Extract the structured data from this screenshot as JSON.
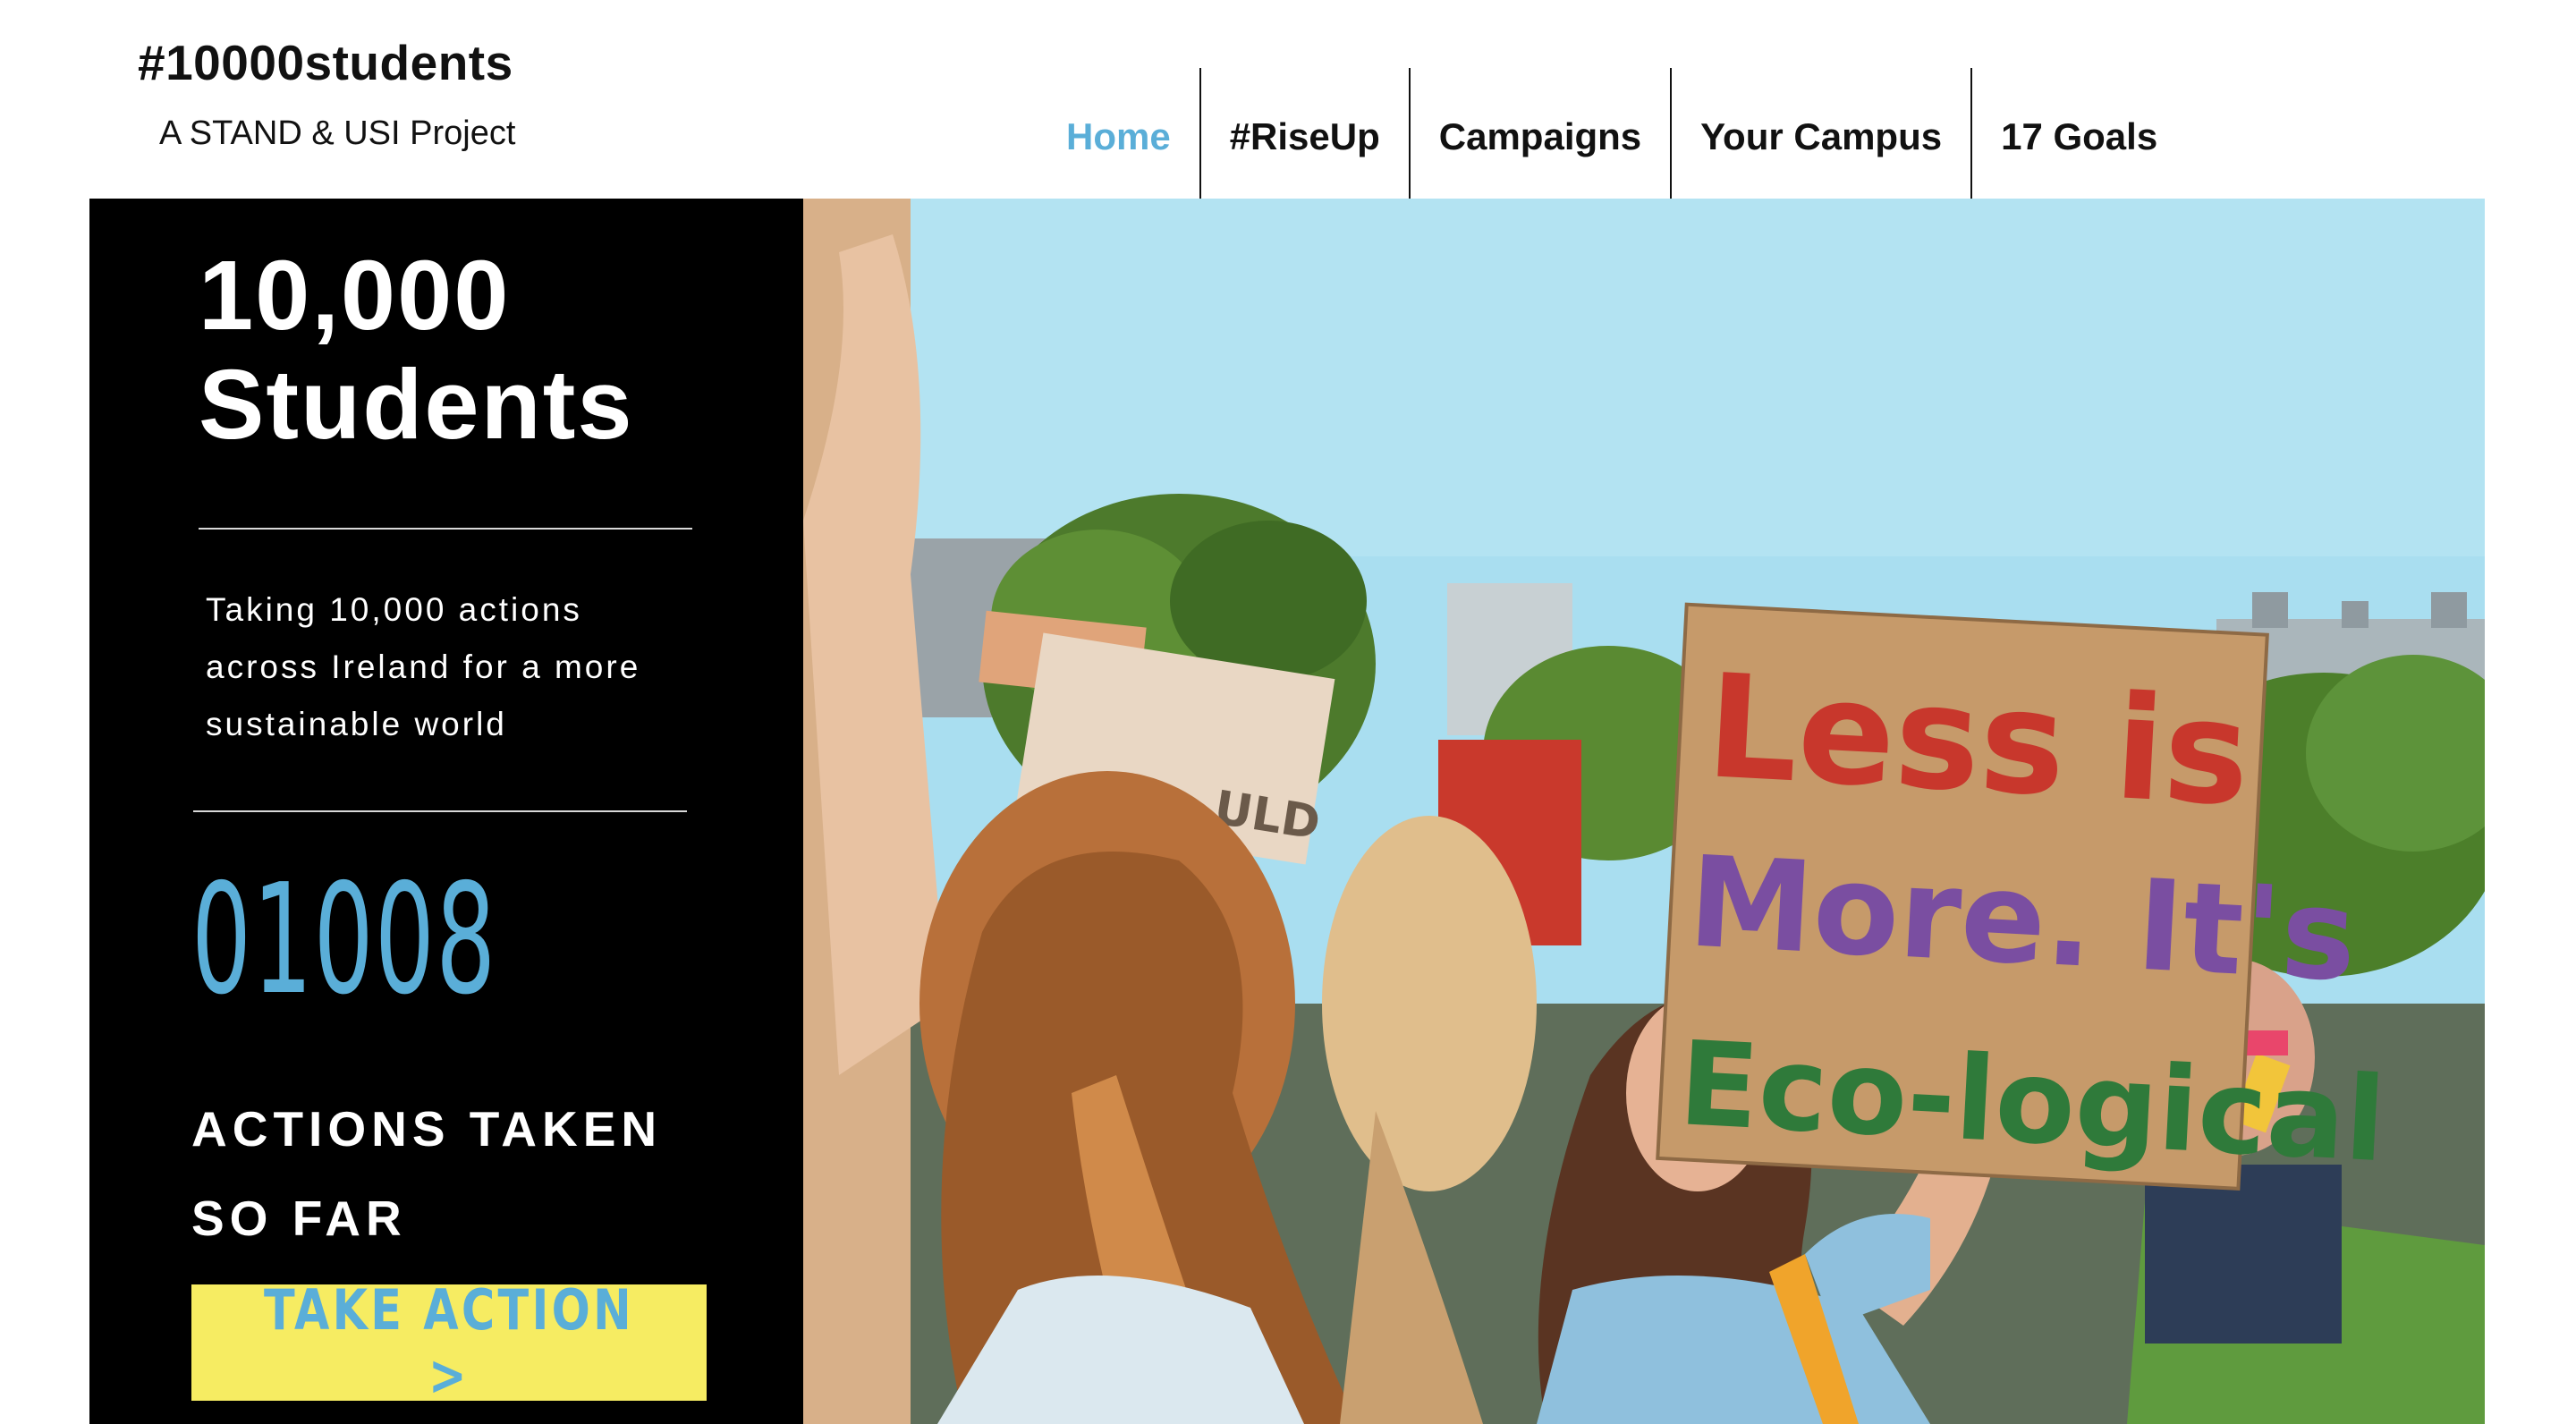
{
  "header": {
    "brand_title": "#10000students",
    "brand_subtitle": "A STAND & USI Project"
  },
  "nav": {
    "items": [
      {
        "label": "Home",
        "active": true
      },
      {
        "label": "#RiseUp",
        "active": false
      },
      {
        "label": "Campaigns",
        "active": false
      },
      {
        "label": "Your Campus",
        "active": false
      },
      {
        "label": "17 Goals",
        "active": false
      }
    ]
  },
  "hero": {
    "title_line1": "10,000",
    "title_line2": "Students",
    "tagline_line1": "Taking 10,000 actions",
    "tagline_line2": "across Ireland for a more",
    "tagline_line3": "sustainable world",
    "counter": "01008",
    "counter_label_line1": "ACTIONS TAKEN",
    "counter_label_line2": "SO FAR",
    "cta_label": "TAKE ACTION >"
  },
  "photo": {
    "alt": "students climate protest with cardboard sign",
    "sign_line1": "Less is",
    "sign_line2": "More. It's",
    "sign_line3": "Eco-logical",
    "back_sign_text": "ULD"
  },
  "colors": {
    "accent_blue": "#5aaed8",
    "cta_yellow": "#f6ec62",
    "panel_black": "#000000",
    "sky": "#a9def0"
  }
}
